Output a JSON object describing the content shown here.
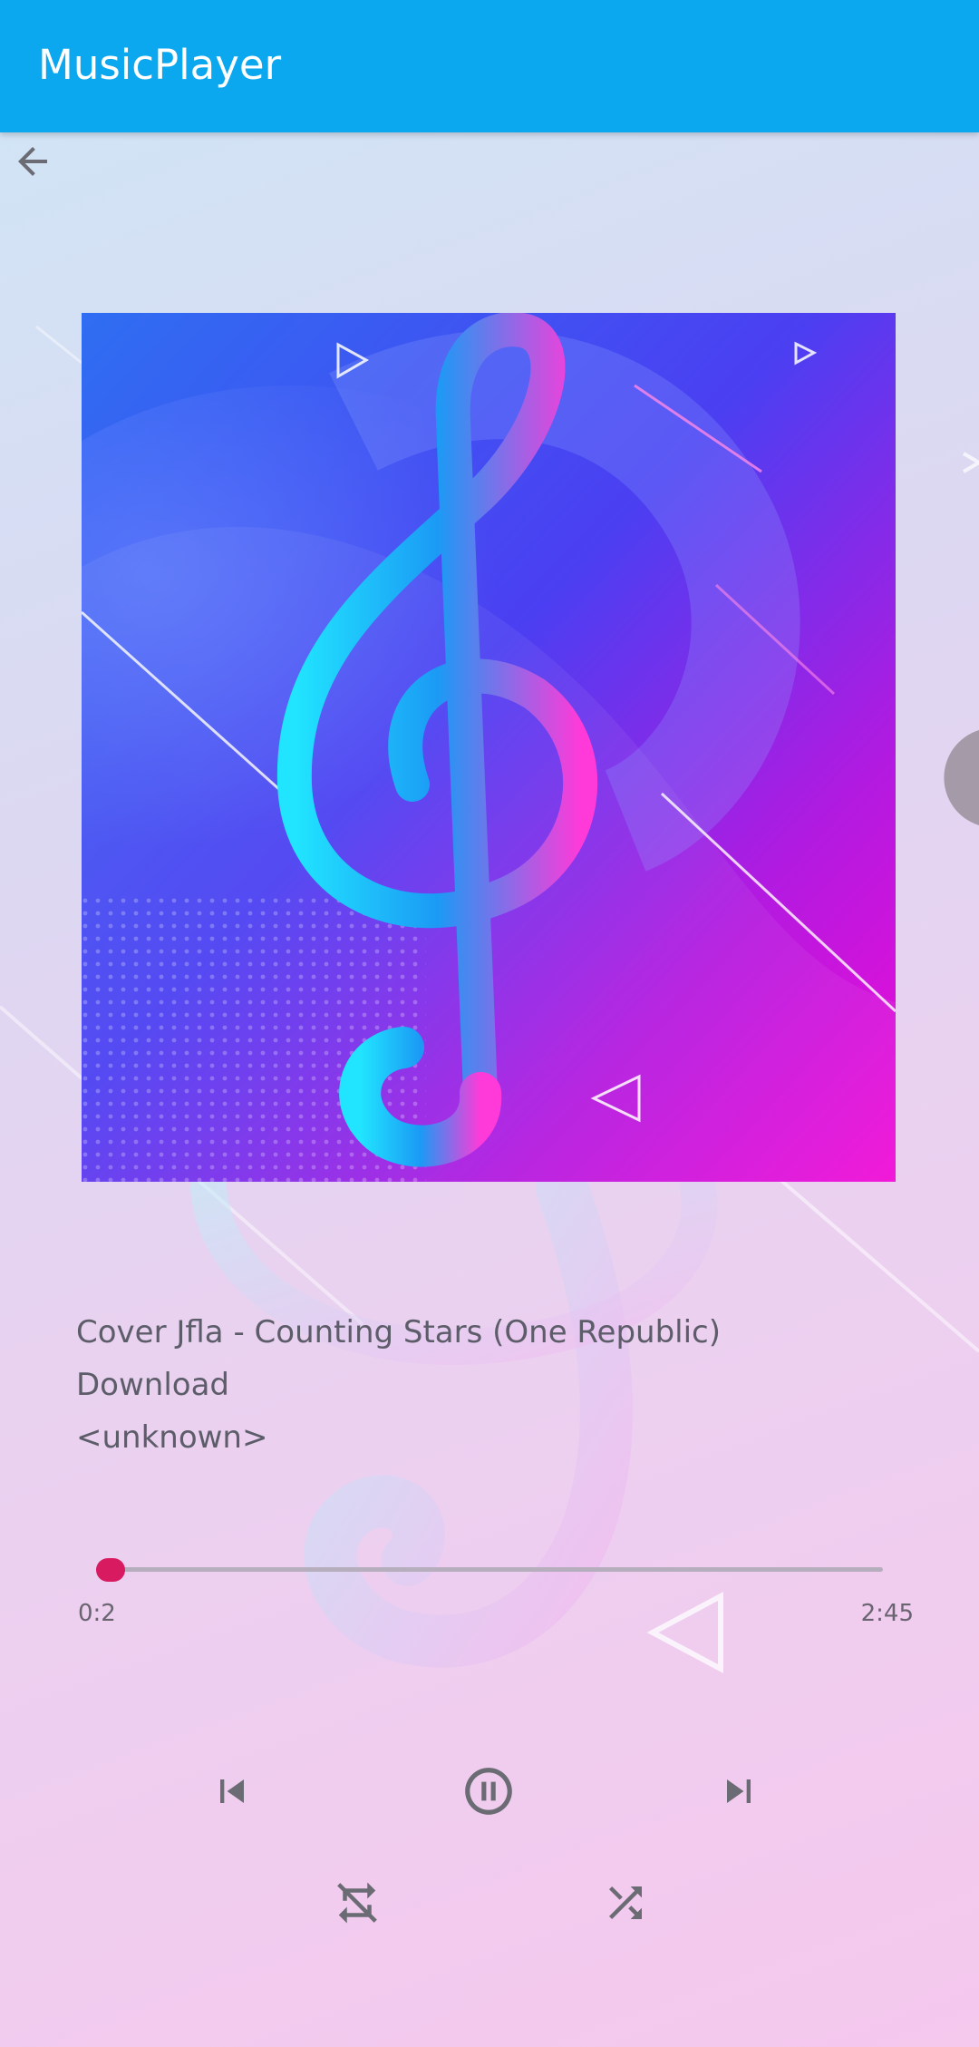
{
  "app_bar": {
    "title": "MusicPlayer",
    "color": "#0BA7EF"
  },
  "navigation": {
    "back_icon": "arrow-left-icon"
  },
  "album_art": {
    "icon": "treble-clef-icon"
  },
  "song": {
    "title": "Cover Jfla - Counting Stars (One Republic)",
    "album": "Download",
    "artist": "<unknown>"
  },
  "playback": {
    "current_time": "0:2",
    "duration": "2:45",
    "progress": 0.012,
    "accent_color": "#D81B60"
  },
  "controls": {
    "previous": "skip-previous-icon",
    "play_pause": "pause-icon",
    "next": "skip-next-icon",
    "repeat": "repeat-off-icon",
    "shuffle": "shuffle-icon"
  }
}
